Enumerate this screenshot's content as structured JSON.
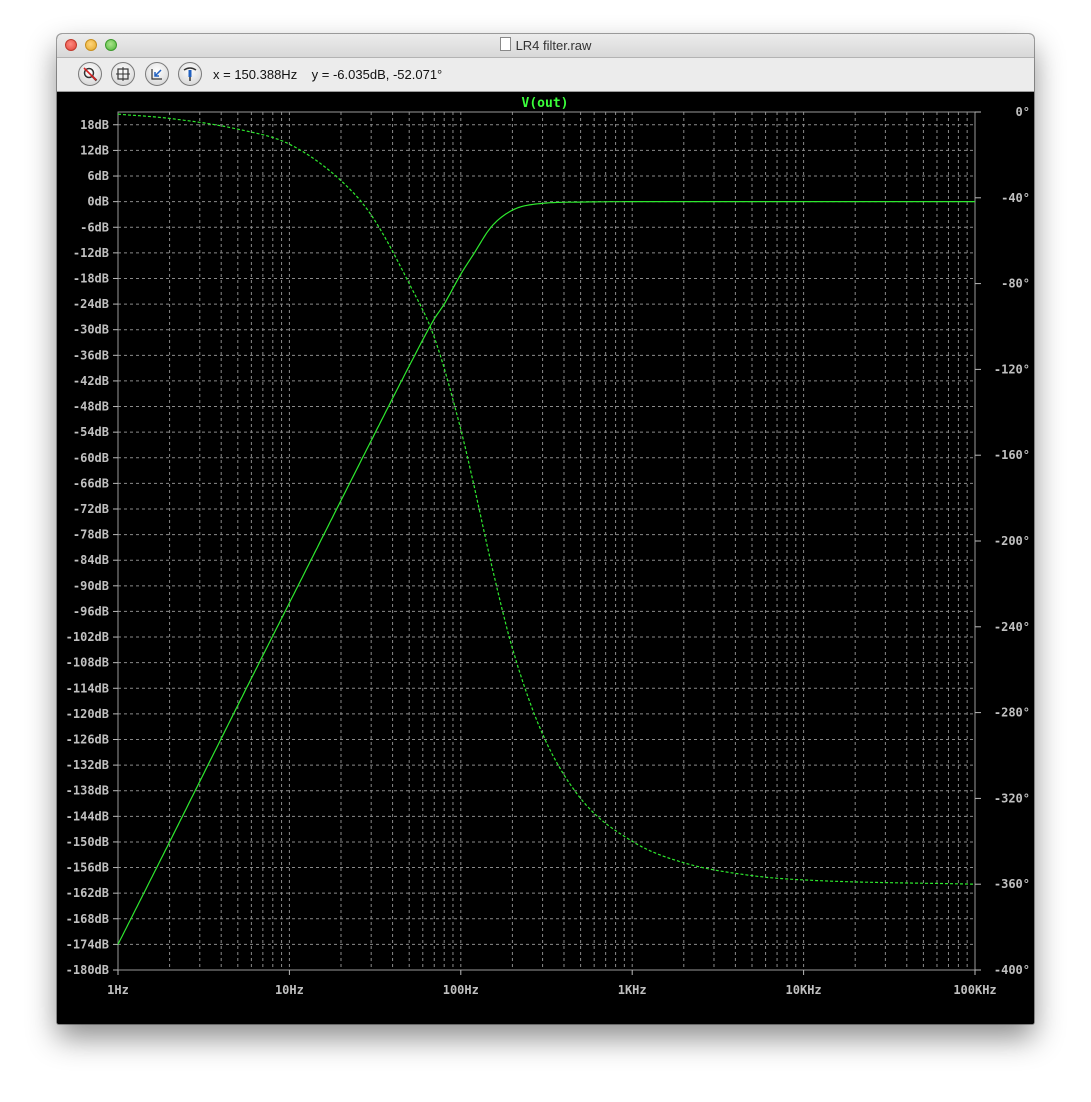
{
  "window": {
    "title": "LR4 filter.raw"
  },
  "toolbar": {
    "icons": [
      "zoom-cancel-icon",
      "autorange-icon",
      "zoom-back-icon",
      "probe-icon"
    ],
    "cursor_x": "x = 150.388Hz",
    "cursor_y": "y = -6.035dB, -52.071°"
  },
  "colors": {
    "trace": "#2ee82e",
    "grid": "#8a8a8a",
    "background": "#000000",
    "title": "#3aff3a",
    "axis_text": "#c0c0c0"
  },
  "chart_data": {
    "type": "line",
    "title": "V(out)",
    "x_scale": "log",
    "xlim": [
      1,
      100000
    ],
    "xticks": [
      1,
      10,
      100,
      1000,
      10000,
      100000
    ],
    "xtick_labels": [
      "1Hz",
      "10Hz",
      "100Hz",
      "1KHz",
      "10KHz",
      "100KHz"
    ],
    "y_left": {
      "unit": "dB",
      "ylim": [
        -180,
        21
      ],
      "ticks": [
        18,
        12,
        6,
        0,
        -6,
        -12,
        -18,
        -24,
        -30,
        -36,
        -42,
        -48,
        -54,
        -60,
        -66,
        -72,
        -78,
        -84,
        -90,
        -96,
        -102,
        -108,
        -114,
        -120,
        -126,
        -132,
        -138,
        -144,
        -150,
        -156,
        -162,
        -168,
        -174,
        -180
      ],
      "tick_labels": [
        "18dB",
        "12dB",
        "6dB",
        "0dB",
        "-6dB",
        "-12dB",
        "-18dB",
        "-24dB",
        "-30dB",
        "-36dB",
        "-42dB",
        "-48dB",
        "-54dB",
        "-60dB",
        "-66dB",
        "-72dB",
        "-78dB",
        "-84dB",
        "-90dB",
        "-96dB",
        "-102dB",
        "-108dB",
        "-114dB",
        "-120dB",
        "-126dB",
        "-132dB",
        "-138dB",
        "-144dB",
        "-150dB",
        "-156dB",
        "-162dB",
        "-168dB",
        "-174dB",
        "-180dB"
      ]
    },
    "y_right": {
      "unit": "°",
      "ylim": [
        -400,
        0
      ],
      "ticks": [
        0,
        -40,
        -80,
        -120,
        -160,
        -200,
        -240,
        -280,
        -320,
        -360,
        -400
      ],
      "tick_labels": [
        "0°",
        "-40°",
        "-80°",
        "-120°",
        "-160°",
        "-200°",
        "-240°",
        "-280°",
        "-320°",
        "-360°",
        "-400°"
      ]
    },
    "grid": true,
    "series": [
      {
        "style": "solid",
        "axis": "left",
        "x": [
          1,
          2,
          5,
          10,
          20,
          30,
          50,
          70,
          80,
          100,
          120,
          150,
          200,
          300,
          500,
          1000,
          10000,
          100000
        ],
        "y": [
          -174,
          -150,
          -118,
          -94,
          -70,
          -56,
          -38.5,
          -27.5,
          -24,
          -17,
          -12,
          -6,
          -2,
          -0.4,
          -0.1,
          0,
          0,
          0
        ]
      },
      {
        "style": "dashed",
        "axis": "right",
        "x": [
          1,
          2,
          5,
          10,
          20,
          30,
          50,
          70,
          100,
          120,
          150,
          200,
          300,
          500,
          1000,
          2000,
          5000,
          10000,
          100000
        ],
        "y": [
          -1,
          -3,
          -8,
          -15,
          -32,
          -48,
          -80,
          -105,
          -148,
          -175,
          -210,
          -250,
          -290,
          -320,
          -340,
          -350,
          -356,
          -358,
          -360
        ]
      }
    ]
  }
}
